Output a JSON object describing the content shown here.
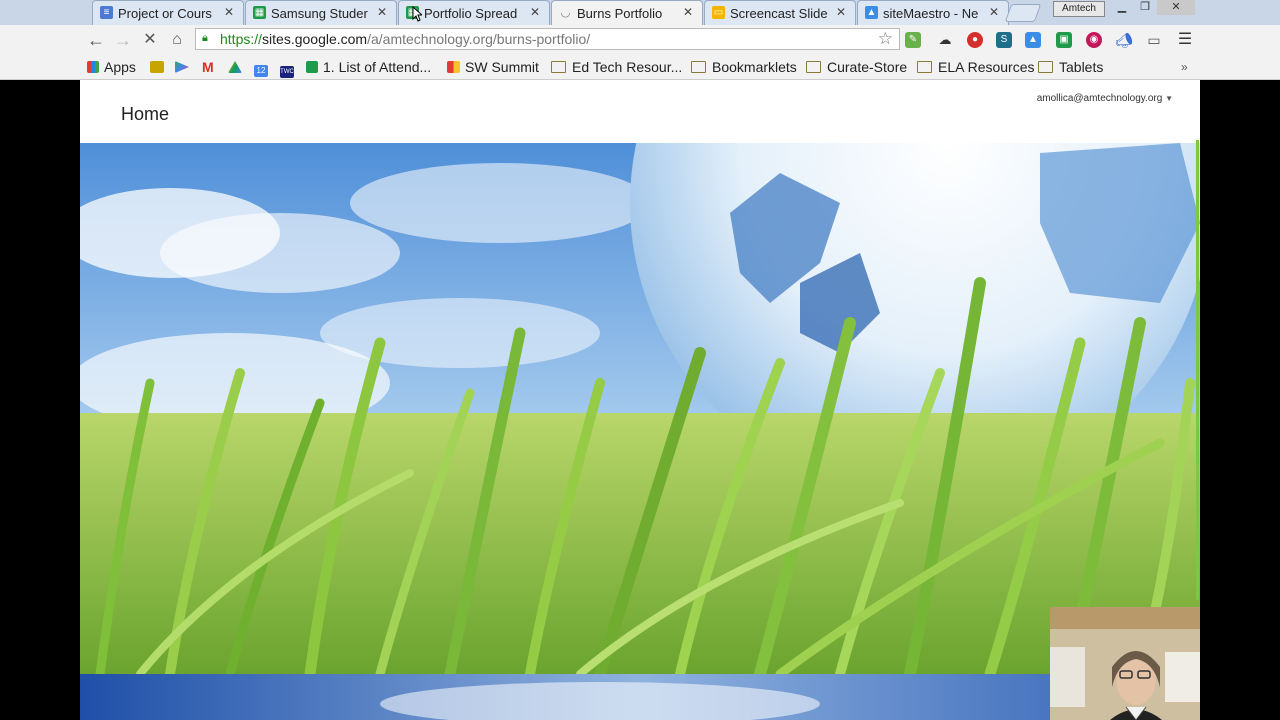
{
  "browser": {
    "tabs": [
      {
        "title": "Project or Cours",
        "icon": "docs-icon",
        "color": "#4a7bd0"
      },
      {
        "title": "Samsung Studer",
        "icon": "sheets-icon",
        "color": "#1e9a4a"
      },
      {
        "title": "Portfolio Spread",
        "icon": "sheets-icon",
        "color": "#1e9a4a"
      },
      {
        "title": "Burns Portfolio",
        "icon": "loading-icon",
        "color": "#888888"
      },
      {
        "title": "Screencast Slide",
        "icon": "slides-icon",
        "color": "#f4b400"
      },
      {
        "title": "siteMaestro - Ne",
        "icon": "drive-icon",
        "color": "#3a8ee6"
      }
    ],
    "user": "Amtech",
    "url": {
      "scheme": "https://",
      "host": "sites.google.com",
      "path": "/a/amtechnology.org/burns-portfolio/"
    },
    "bookmarks": [
      {
        "label": "Apps",
        "type": "apps"
      },
      {
        "label": "1. List of Attend...",
        "type": "sheet"
      },
      {
        "label": "SW Summit",
        "type": "site"
      },
      {
        "label": "Ed Tech Resour...",
        "type": "folder"
      },
      {
        "label": "Bookmarklets",
        "type": "folder"
      },
      {
        "label": "Curate-Store",
        "type": "folder"
      },
      {
        "label": "ELA Resources",
        "type": "folder"
      },
      {
        "label": "Tablets",
        "type": "folder"
      }
    ],
    "bookmark_small_labels": {
      "calendar": "12",
      "twc": "TWC"
    }
  },
  "site": {
    "title": "Home",
    "account": "amollica@amtechnology.org"
  },
  "colors": {
    "sky": "#6da7e0",
    "grass": "#8cc63f",
    "tabstrip": "#c9d6e8"
  }
}
